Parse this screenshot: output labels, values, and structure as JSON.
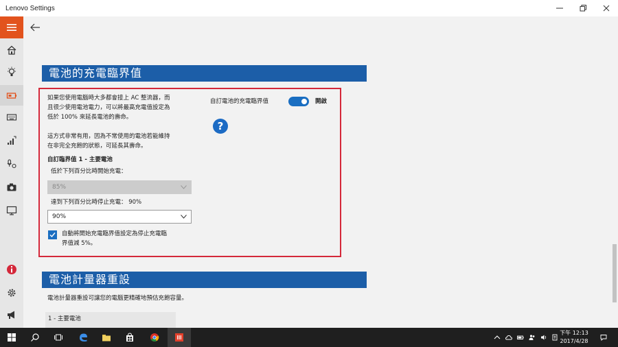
{
  "window": {
    "title": "Lenovo Settings"
  },
  "section1": {
    "header": "電池的充電臨界值",
    "desc1": [
      "如果您使用電腦時大多都會接上 AC 整流器，而",
      "且很少使用電池電力，可以將最高充電值設定為",
      "低於 100% 來延長電池的壽命。"
    ],
    "desc2": [
      "這方式非常有用，因為不常使用的電池若能維持",
      "在非完全充飽的狀態，可延長其壽命。"
    ],
    "custom_title": "自訂臨界值 1 - 主要電池",
    "start_label": "低於下列百分比時開始充電：",
    "start_value": "85%",
    "stop_label": "達到下列百分比時停止充電： 90%",
    "stop_value": "90%",
    "auto_label": [
      "自動將開始充電臨界值設定為停止充電臨",
      "界值減 5%。"
    ],
    "toggle_label": "自訂電池的充電臨界值",
    "toggle_state": "開啟",
    "help_symbol": "?"
  },
  "section2": {
    "header": "電池計量器重設",
    "desc": "電池計量器重設可讓您的電腦更精確地預估充飽容量。",
    "battery_item": "1 - 主要電池"
  },
  "taskbar": {
    "clock_line1": "下午 12:13",
    "clock_line2": "2017/4/28"
  },
  "colors": {
    "accent": "#1c5ea8",
    "highlight_border": "#d4283a",
    "hamburger": "#e2531d"
  }
}
